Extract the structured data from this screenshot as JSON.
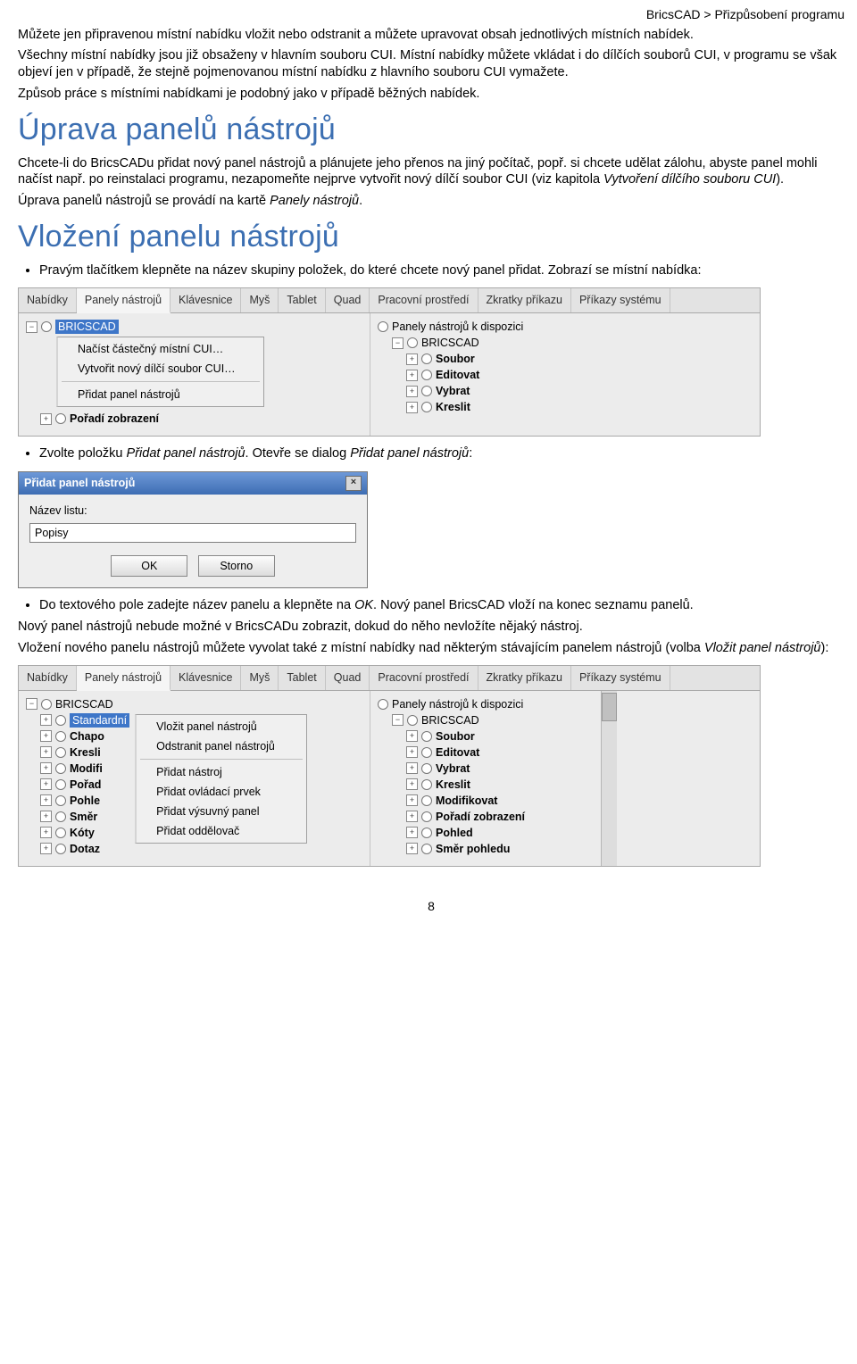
{
  "breadcrumb": "BricsCAD > Přizpůsobení programu",
  "intro": {
    "p1": "Můžete jen připravenou místní nabídku vložit nebo odstranit a můžete upravovat obsah jednotlivých místních nabídek.",
    "p2": "Všechny místní nabídky jsou již obsaženy v hlavním souboru CUI. Místní nabídky můžete vkládat i do dílčích souborů CUI, v programu se však objeví jen v případě, že stejně pojmenovanou místní nabídku z hlavního souboru CUI vymažete.",
    "p3": "Způsob práce s místními nabídkami je podobný jako v případě běžných nabídek."
  },
  "h1a": "Úprava panelů nástrojů",
  "secA": {
    "p1a": "Chcete-li do BricsCADu přidat nový panel nástrojů a plánujete jeho přenos na jiný počítač, popř. si chcete udělat zálohu, abyste panel mohli načíst např. po reinstalaci programu, nezapomeňte nejprve vytvořit nový dílčí soubor CUI (viz kapitola ",
    "p1em": "Vytvoření dílčího souboru CUI",
    "p1b": ").",
    "p2a": "Úprava panelů nástrojů se provádí na kartě ",
    "p2em": "Panely nástrojů",
    "p2b": "."
  },
  "h1b": "Vložení panelu nástrojů",
  "bul1": "Pravým tlačítkem klepněte na název skupiny položek, do které chcete nový panel přidat. Zobrazí se místní nabídka:",
  "tabs": [
    "Nabídky",
    "Panely nástrojů",
    "Klávesnice",
    "Myš",
    "Tablet",
    "Quad",
    "Pracovní prostředí",
    "Zkratky příkazu",
    "Příkazy systému"
  ],
  "tree1": {
    "root": "BRICSCAD",
    "ctx": {
      "i1": "Načíst částečný místní CUI…",
      "i2": "Vytvořit nový dílčí soubor CUI…",
      "i3": "Přidat panel nástrojů",
      "i4": "Pořadí zobrazení"
    },
    "right_title": "Panely nástrojů k dispozici",
    "right_root": "BRICSCAD",
    "right_items": [
      "Soubor",
      "Editovat",
      "Vybrat",
      "Kreslit"
    ]
  },
  "bul2a": "Zvolte položku ",
  "bul2em1": "Přidat panel nástrojů",
  "bul2b": ". Otevře se dialog ",
  "bul2em2": "Přidat panel nástrojů",
  "bul2c": ":",
  "dialog": {
    "title": "Přidat panel nástrojů",
    "label": "Název listu:",
    "value": "Popisy",
    "ok": "OK",
    "cancel": "Storno"
  },
  "bul3a": "Do textového pole zadejte název panelu a klepněte na ",
  "bul3em": "OK",
  "bul3b": ". Nový panel BricsCAD vloží na konec seznamu panelů.",
  "after1": "Nový panel nástrojů nebude možné v BricsCADu zobrazit, dokud do něho nevložíte nějaký nástroj.",
  "after2a": "Vložení nového panelu nástrojů můžete vyvolat také z místní nabídky nad některým stávajícím panelem nástrojů (volba ",
  "after2em": "Vložit panel nástrojů",
  "after2b": "):",
  "tree2": {
    "root": "BRICSCAD",
    "left": [
      "Standardní",
      "Chapo",
      "Kresli",
      "Modifi",
      "Pořad",
      "Pohle",
      "Směr",
      "Kóty",
      "Dotaz"
    ],
    "ctx": [
      "Vložit panel nástrojů",
      "Odstranit panel nástrojů",
      "Přidat nástroj",
      "Přidat ovládací prvek",
      "Přidat výsuvný panel",
      "Přidat oddělovač"
    ],
    "right_title": "Panely nástrojů k dispozici",
    "right_root": "BRICSCAD",
    "right_items": [
      "Soubor",
      "Editovat",
      "Vybrat",
      "Kreslit",
      "Modifikovat",
      "Pořadí zobrazení",
      "Pohled",
      "Směr pohledu"
    ]
  },
  "pagenum": "8"
}
